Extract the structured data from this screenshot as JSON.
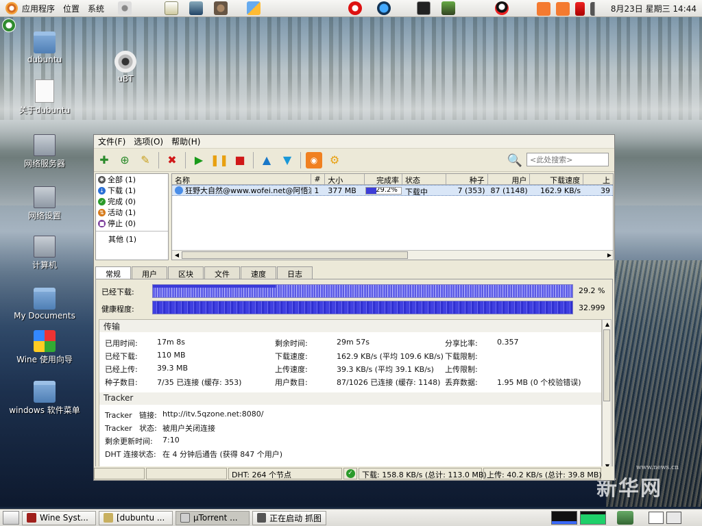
{
  "top_panel": {
    "menus": [
      "应用程序",
      "位置",
      "系统"
    ],
    "clock": "8月23日 星期三 14:44"
  },
  "desktop": {
    "icons": [
      "dubuntu",
      "uBT",
      "关于dubuntu",
      "网络服务器",
      "网络设置",
      "计算机",
      "My Documents",
      "Wine 使用向导",
      "windows 软件菜单"
    ]
  },
  "window": {
    "menus": [
      "文件(F)",
      "选项(O)",
      "帮助(H)"
    ],
    "search_placeholder": "<此处搜索>",
    "categories": [
      {
        "label": "全部 (1)",
        "color": "#555555"
      },
      {
        "label": "下载 (1)",
        "color": "#2a6fd6"
      },
      {
        "label": "完成 (0)",
        "color": "#2a9a2a"
      },
      {
        "label": "活动 (1)",
        "color": "#d67a1a"
      },
      {
        "label": "停止 (0)",
        "color": "#7a3a9a"
      }
    ],
    "category_other": "其他 (1)",
    "columns": [
      "名称",
      "#",
      "大小",
      "完成率",
      "状态",
      "种子",
      "用户",
      "下载速度",
      "上"
    ],
    "torrent": {
      "name": "狂野大自然@www.wofei.net@阿悟浪子",
      "index": "1",
      "size": "377 MB",
      "progress_label": "29.2%",
      "progress": 0.292,
      "status": "下载中",
      "seeds": "7 (353)",
      "peers": "87 (1148)",
      "down_speed": "162.9 KB/s",
      "up_partial": "39"
    },
    "tabs": [
      "常规",
      "用户",
      "区块",
      "文件",
      "速度",
      "日志"
    ],
    "downloaded_label": "已经下载:",
    "downloaded_value": "29.2 %",
    "downloaded_fill": 0.292,
    "health_label": "健康程度:",
    "health_value": "32.999",
    "health_fill": 1.0,
    "transfer_title": "传输",
    "transfer": {
      "elapsed_k": "已用时间:",
      "elapsed_v": "17m 8s",
      "remaining_k": "剩余时间:",
      "remaining_v": "29m 57s",
      "ratio_k": "分享比率:",
      "ratio_v": "0.357",
      "downloaded_k": "已经下载:",
      "downloaded_v": "110 MB",
      "dlspeed_k": "下载速度:",
      "dlspeed_v": "162.9 KB/s (平均 109.6 KB/s)",
      "dllimit_k": "下载限制:",
      "uploaded_k": "已经上传:",
      "uploaded_v": "39.3 MB",
      "ulspeed_k": "上传速度:",
      "ulspeed_v": "39.3 KB/s (平均 39.1 KB/s)",
      "ullimit_k": "上传限制:",
      "seeds_k": "种子数目:",
      "seeds_v": "7/35 已连接 (缓存: 353)",
      "peers_k": "用户数目:",
      "peers_v": "87/1026 已连接 (缓存: 1148)",
      "wasted_k": "丢弃数据:",
      "wasted_v": "1.95 MB (0 个校验错误)"
    },
    "tracker_title": "Tracker",
    "tracker": {
      "link_k": "Tracker   链接:",
      "link_v": "http://itv.5qzone.net:8080/",
      "status_k": "Tracker   状态:",
      "status_v": "被用户关闭连接",
      "update_k": "剩余更新时间:",
      "update_v": "7:10",
      "dht_k": "DHT 连接状态:",
      "dht_v": "在 4 分钟后通告 (获得 847 个用户)"
    },
    "status_bar": {
      "dht": "DHT: 264 个节点",
      "download": "下载: 158.8 KB/s (总计: 113.0 MB)",
      "upload": "上传: 40.2 KB/s (总计: 39.8 MB)"
    }
  },
  "taskbar": {
    "tasks": [
      "Wine Syst...",
      "[dubuntu ...",
      "µTorrent ...",
      "正在启动 抓图"
    ]
  },
  "watermark": {
    "text": "新华网",
    "sub": "www.news.cn"
  }
}
